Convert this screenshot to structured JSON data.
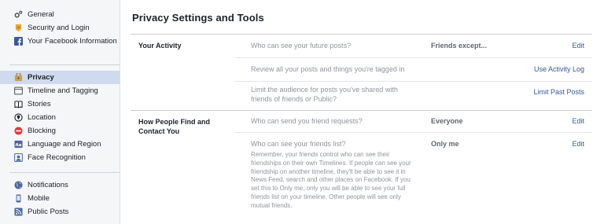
{
  "sidebar": {
    "group1": [
      {
        "label": "General",
        "icon": "gear-icon"
      },
      {
        "label": "Security and Login",
        "icon": "badge-icon"
      },
      {
        "label": "Your Facebook Information",
        "icon": "facebook-icon"
      }
    ],
    "group2": [
      {
        "label": "Privacy",
        "icon": "privacy-lock-icon",
        "active": true
      },
      {
        "label": "Timeline and Tagging",
        "icon": "timeline-icon"
      },
      {
        "label": "Stories",
        "icon": "book-icon"
      },
      {
        "label": "Location",
        "icon": "location-icon"
      },
      {
        "label": "Blocking",
        "icon": "blocking-icon"
      },
      {
        "label": "Language and Region",
        "icon": "language-icon"
      },
      {
        "label": "Face Recognition",
        "icon": "face-recognition-icon"
      }
    ],
    "group3": [
      {
        "label": "Notifications",
        "icon": "globe-icon"
      },
      {
        "label": "Mobile",
        "icon": "mobile-icon"
      },
      {
        "label": "Public Posts",
        "icon": "rss-icon"
      }
    ]
  },
  "main": {
    "title": "Privacy Settings and Tools",
    "sections": [
      {
        "title": "Your Activity",
        "rows": [
          {
            "question": "Who can see your future posts?",
            "value": "Friends except...",
            "action": "Edit"
          },
          {
            "question": "Review all your posts and things you're tagged in",
            "value": "",
            "action": "Use Activity Log"
          },
          {
            "question": "Limit the audience for posts you've shared with friends of friends or Public?",
            "value": "",
            "action": "Limit Past Posts"
          }
        ]
      },
      {
        "title": "How People Find and Contact You",
        "rows": [
          {
            "question": "Who can send you friend requests?",
            "value": "Everyone",
            "action": "Edit"
          },
          {
            "question": "Who can see your friends list?",
            "value": "Only me",
            "action": "Edit",
            "description": "Remember, your friends control who can see their friendships on their own Timelines. If people can see your friendship on another timeline, they'll be able to see it in News Feed, search and other places on Facebook. If you set this to Only me, only you will be able to see your full friends list on your timeline. Other people will see only mutual friends."
          }
        ]
      }
    ]
  },
  "colors": {
    "link": "#365899",
    "active_bg": "#cfdaee",
    "sidebar_bg": "#f5f6f7",
    "muted_text": "#90949c"
  }
}
